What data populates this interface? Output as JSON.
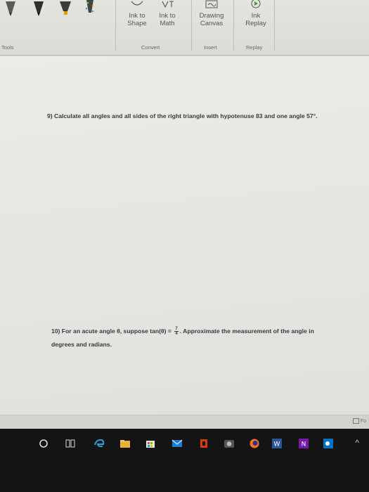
{
  "ribbon": {
    "buttons": {
      "ink_to_shape": "Ink to\nShape",
      "ink_to_math": "Ink to\nMath",
      "drawing_canvas": "Drawing\nCanvas",
      "ink_replay": "Ink\nReplay"
    },
    "groups": {
      "tools": "Tools",
      "convert": "Convert",
      "insert": "Insert",
      "replay": "Replay"
    },
    "pen_colors": [
      "#4a4a4a",
      "#2d2d2d",
      "#d4a800",
      "#3a3a3a"
    ]
  },
  "document": {
    "q9": "9)  Calculate all angles and all sides of the right triangle with hypotenuse 83 and one angle 57°.",
    "q10_prefix": "10)  For an acute angle θ, suppose tan(θ) = ",
    "q10_frac_num": "7",
    "q10_frac_den": "4",
    "q10_suffix": ". Approximate the measurement of the angle in",
    "q10_line2": "degrees and radians."
  },
  "status": {
    "zoom_label": "Fo"
  },
  "taskbar": {
    "icons": [
      "search-circle",
      "task-view",
      "edge",
      "file-explorer",
      "store",
      "mail",
      "office",
      "camera",
      "firefox",
      "word",
      "onenote",
      "outlook"
    ]
  }
}
